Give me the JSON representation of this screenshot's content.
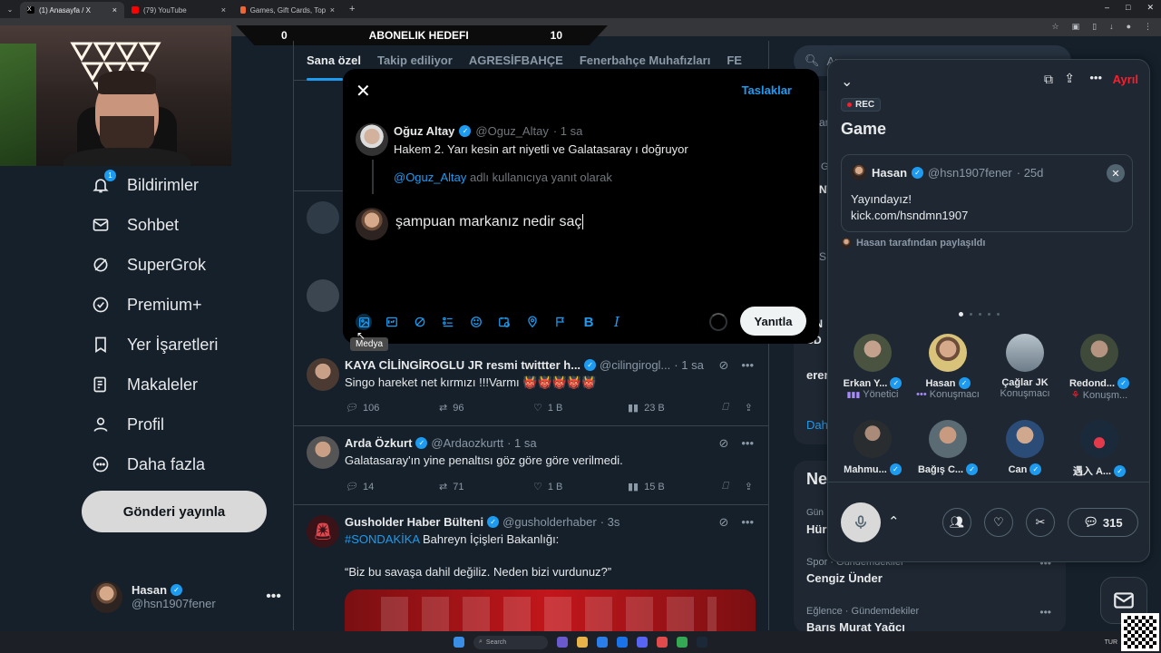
{
  "browser": {
    "tabs": [
      {
        "title": "(1) Anasayfa / X",
        "active": true
      },
      {
        "title": "(79) YouTube",
        "active": false
      },
      {
        "title": "Games, Gift Cards, Top-Ups & ...",
        "active": false
      }
    ],
    "new_tab": "+"
  },
  "stream_overlay": {
    "left_value": "0",
    "title": "ABONELIK HEDEFI",
    "right_value": "10"
  },
  "nav": {
    "notifications": "Bildirimler",
    "notifications_badge": "1",
    "chat": "Sohbet",
    "supergrok": "SuperGrok",
    "premium": "Premium+",
    "bookmarks": "Yer İşaretleri",
    "articles": "Makaleler",
    "profile": "Profil",
    "more": "Daha fazla",
    "post_button": "Gönderi yayınla",
    "account_name": "Hasan",
    "account_handle": "@hsn1907fener"
  },
  "timeline": {
    "tabs": [
      "Sana özel",
      "Takip ediliyor",
      "AGRESİFBAHÇE",
      "Fenerbahçe Muhafızları",
      "FE"
    ],
    "tweets": [
      {
        "name": "KAYA CİLİNGİROGLU JR resmi twittter h...",
        "handle": "@cilingirogl...",
        "time": "· 1 sa",
        "text": "Singo hareket net kırmızı !!!Varmı 👹👹👹👹👹",
        "replies": "106",
        "reposts": "96",
        "likes": "1 B",
        "views": "23 B"
      },
      {
        "name": "Arda Özkurt",
        "handle": "@Ardaozkurtt",
        "time": "· 1 sa",
        "text": "Galatasaray'ın yine penaltısı göz göre göre verilmedi.",
        "replies": "14",
        "reposts": "71",
        "likes": "1 B",
        "views": "15 B"
      },
      {
        "name": "Gusholder Haber Bülteni",
        "handle": "@gusholderhaber",
        "time": "· 3s",
        "hashtag": "#SONDAKİKA",
        "text": "Bahreyn İçişleri Bakanlığı:",
        "quote": "“Biz bu savaşa dahil değiliz. Neden bizi vurdunuz?”"
      }
    ]
  },
  "reply_modal": {
    "drafts": "Taslaklar",
    "original_name": "Oğuz Altay",
    "original_handle": "@Oguz_Altay",
    "original_time": "· 1 sa",
    "original_text": "Hakem 2. Yarı kesin art niyetli ve Galatasaray ı doğruyor",
    "reply_to_handle": "@Oguz_Altay",
    "reply_to_suffix": "adlı kullanıcıya yanıt olarak",
    "compose_text": "şampuan markanız nedir saç",
    "reply_button": "Yanıtla",
    "media_tooltip": "Medya",
    "toolbar_icons": [
      "image-icon",
      "gif-icon",
      "grok-icon",
      "poll-icon",
      "emoji-icon",
      "schedule-icon",
      "location-icon",
      "flag-icon",
      "bold-icon",
      "italic-icon"
    ]
  },
  "right_column": {
    "search_placeholder": "Ar",
    "show_more": "Daha",
    "whats_happening": "Ne",
    "trends": [
      {
        "meta": "Spor · Gündemdekiler",
        "title": "Cengiz Ünder"
      },
      {
        "meta": "Eğlence · Gündemdekiler",
        "title": "Barış Murat Yağcı"
      }
    ],
    "side_snippets": [
      "an",
      "G",
      "NT",
      "S",
      "eren",
      "ON",
      "SD",
      "Gün",
      "Hür"
    ]
  },
  "spaces": {
    "leave": "Ayrıl",
    "rec": "REC",
    "title": "Game",
    "pinned_name": "Hasan",
    "pinned_handle": "@hsn1907fener",
    "pinned_time": "· 25d",
    "pinned_line1": "Yayındayız!",
    "pinned_line2": "kick.com/hsndmn1907",
    "shared_by": "Hasan tarafından paylaşıldı",
    "users": [
      {
        "name": "Erkan Y...",
        "role": "Yönetici",
        "role_icon": "▮▮▮",
        "role_color": "#a78bfa"
      },
      {
        "name": "Hasan",
        "role": "Konuşmacı",
        "role_icon": "•••",
        "role_color": "#a78bfa"
      },
      {
        "name": "Çağlar JK",
        "role": "Konuşmacı",
        "role_icon": "",
        "role_color": "#8b98a5"
      },
      {
        "name": "Redond...",
        "role": "Konuşm...",
        "role_icon": "⚘",
        "role_color": "#f4212e"
      },
      {
        "name": "Mahmu...",
        "role": "",
        "role_icon": "",
        "role_color": "#8b98a5"
      },
      {
        "name": "Bağış C...",
        "role": "",
        "role_icon": "",
        "role_color": "#8b98a5"
      },
      {
        "name": "Can",
        "role": "",
        "role_icon": "",
        "role_color": "#8b98a5"
      },
      {
        "name": "遇入 A...",
        "role": "",
        "role_icon": "",
        "role_color": "#8b98a5"
      }
    ],
    "comment_count": "315"
  },
  "taskbar": {
    "search": "Search",
    "lang": "TUR"
  },
  "colors": {
    "accent": "#1d9bf0",
    "leave": "#f4212e",
    "bg": "#15202b",
    "panel": "#1e2732"
  }
}
